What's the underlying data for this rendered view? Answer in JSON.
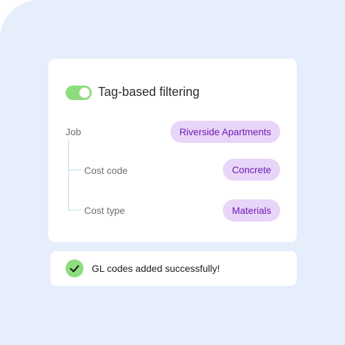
{
  "filter_card": {
    "toggle_state": "on",
    "title": "Tag-based filtering",
    "rows": [
      {
        "label": "Job",
        "tag": "Riverside Apartments"
      },
      {
        "label": "Cost code",
        "tag": "Concrete"
      },
      {
        "label": "Cost type",
        "tag": "Materials"
      }
    ]
  },
  "toast": {
    "message": "GL codes added successfully!"
  },
  "colors": {
    "background": "#e6eefb",
    "toggle_on": "#8fdc7f",
    "tag_background": "#e9d5f7",
    "tag_text": "#6a1bb5",
    "tree_line": "#b8e2ec",
    "success": "#8fdc7f"
  },
  "icons": {
    "toast_icon": "check-circle-icon"
  }
}
